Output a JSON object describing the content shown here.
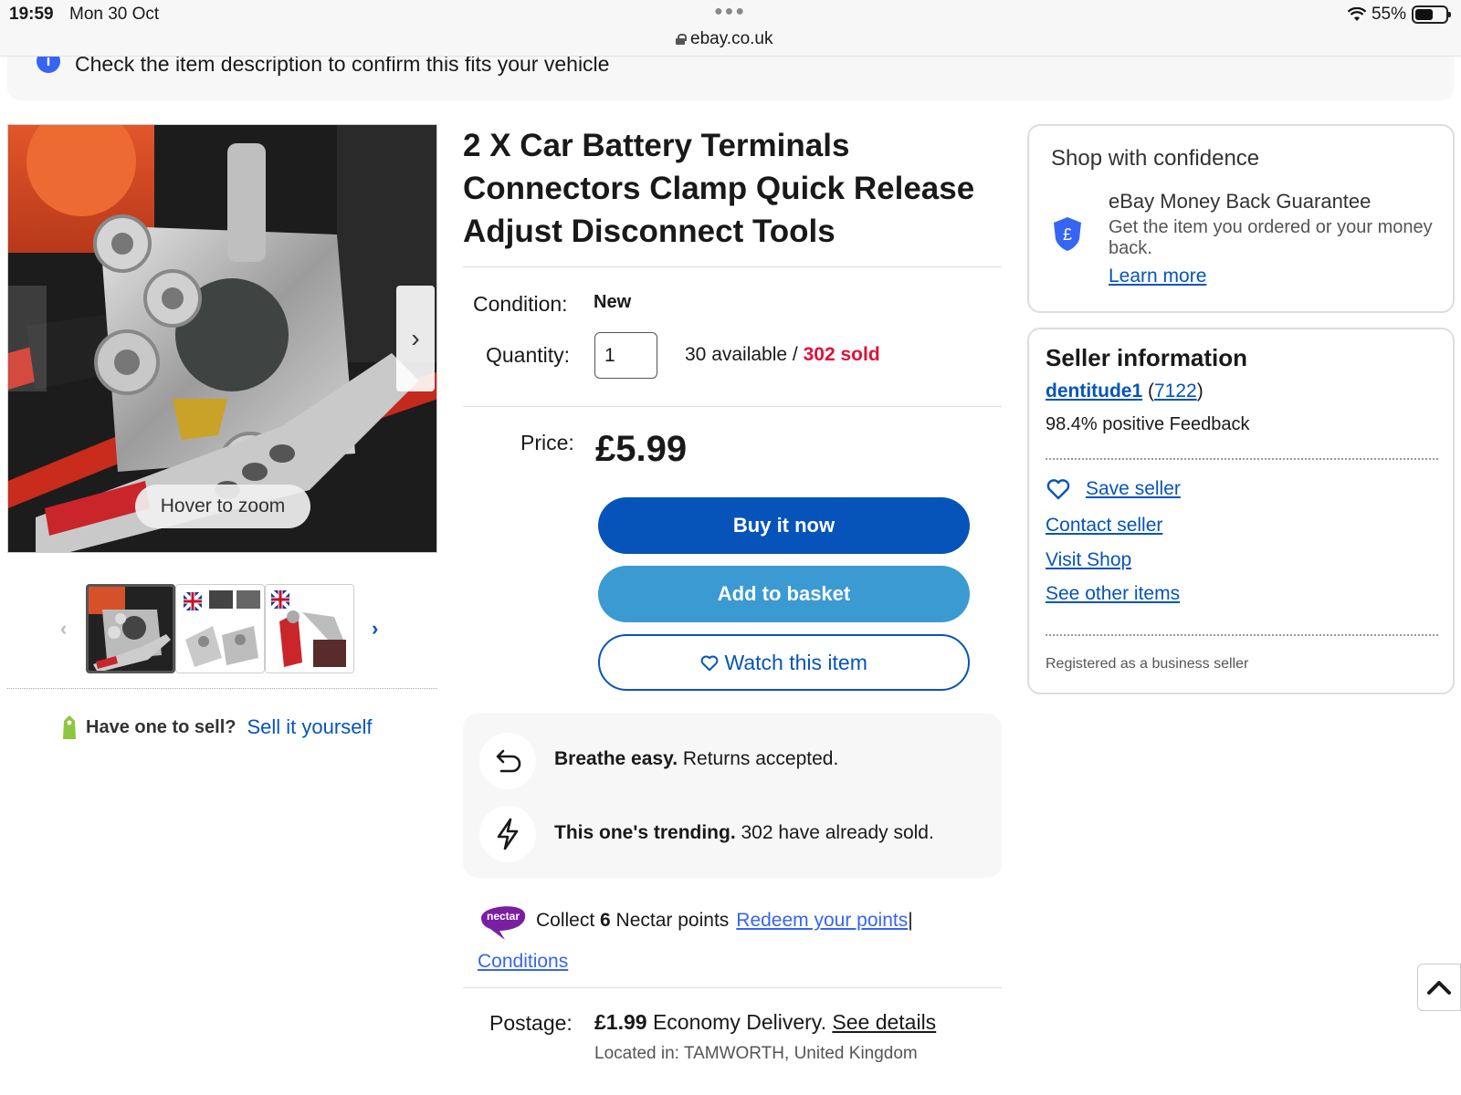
{
  "status_bar": {
    "time": "19:59",
    "date": "Mon 30 Oct",
    "url": "ebay.co.uk",
    "battery": "55%"
  },
  "notice": {
    "text": "Check the item description to confirm this fits your vehicle"
  },
  "gallery": {
    "zoom_hint": "Hover to zoom",
    "thumbnail_count": 3,
    "active_thumbnail": 1
  },
  "sell": {
    "label": "Have one to sell?",
    "link": "Sell it yourself"
  },
  "listing": {
    "title": "2 X Car Battery Terminals Connectors Clamp Quick Release Adjust Disconnect Tools",
    "condition_label": "Condition:",
    "condition_value": "New",
    "quantity_label": "Quantity:",
    "quantity_value": "1",
    "available": "30 available",
    "separator": " / ",
    "sold": "302 sold",
    "price_label": "Price:",
    "price": "£5.99"
  },
  "actions": {
    "buy_now": "Buy it now",
    "add_to_basket": "Add to basket",
    "watch": "Watch this item"
  },
  "perks": {
    "returns_bold": "Breathe easy.",
    "returns_text": " Returns accepted.",
    "trending_bold": "This one's trending.",
    "trending_text": " 302 have already sold."
  },
  "nectar": {
    "logo_text": "nectar",
    "collect_prefix": "Collect ",
    "points": "6",
    "collect_suffix": " Nectar points ",
    "redeem_link": "Redeem your points",
    "divider": " |",
    "conditions_link": "Conditions"
  },
  "postage": {
    "label": "Postage:",
    "price": "£1.99",
    "method": " Economy Delivery. ",
    "details_link": "See details",
    "location": "Located in: TAMWORTH, United Kingdom"
  },
  "confidence": {
    "title": "Shop with confidence",
    "guarantee_title": "eBay Money Back Guarantee",
    "guarantee_desc": "Get the item you ordered or your money back.",
    "learn_more": "Learn more"
  },
  "seller": {
    "title": "Seller information",
    "name": "dentitude1",
    "score_open": " (",
    "score": "7122",
    "score_close": ")",
    "feedback": "98.4% positive Feedback",
    "save_seller": "Save seller",
    "contact_seller": "Contact seller",
    "visit_shop": "Visit Shop",
    "see_other_items": "See other items",
    "business_note": "Registered as a business seller"
  },
  "colors": {
    "ebay_blue": "#0654ba",
    "basket_blue": "#3b9ad1",
    "sold_red": "#e0103a",
    "nectar_purple": "#7a1fa2"
  }
}
